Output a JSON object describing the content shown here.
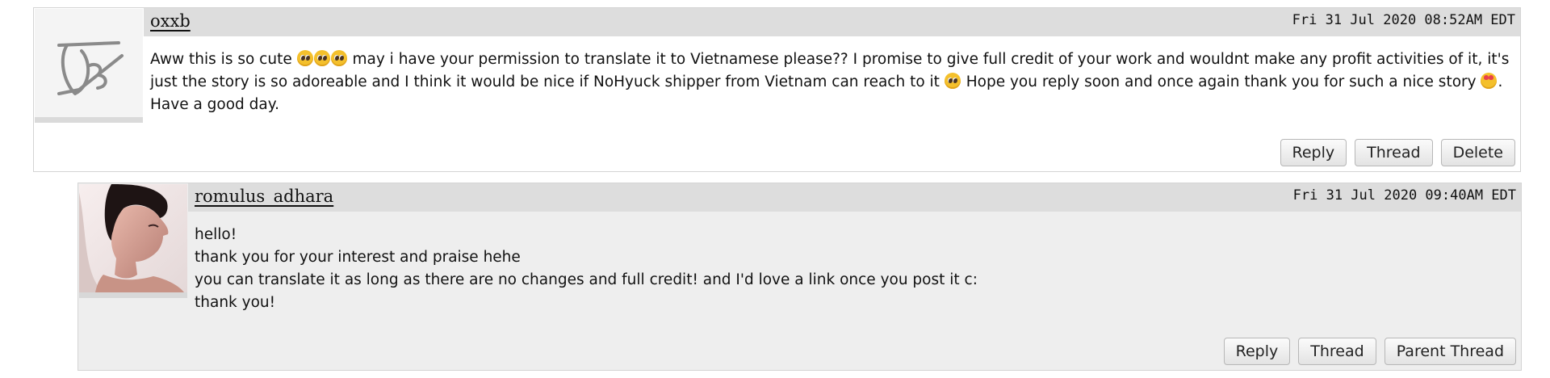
{
  "comments": [
    {
      "user": "oxxb",
      "timestamp": "Fri 31 Jul 2020 08:52AM EDT",
      "avatar_icon": "oxxb-logo-icon",
      "body": {
        "l1a": "Aww this is so cute",
        "l1b": "may i have your permission to translate it to Vietnamese please?? I promise to give full credit of your work and wouldnt make any profit activities of it, it's",
        "l2a": "just the story is so adoreable and I think it would be nice if NoHyuck shipper from Vietnam can reach to it",
        "l2b": "Hope you reply soon and once again thank you for such a nice story",
        "l2c": ".",
        "l3": "Have a good day."
      },
      "buttons": {
        "reply": "Reply",
        "thread": "Thread",
        "delete": "Delete"
      }
    },
    {
      "user": "romulus_adhara",
      "timestamp": "Fri 31 Jul 2020 09:40AM EDT",
      "avatar_icon": "profile-photo",
      "lines": [
        "hello!",
        "thank you for your interest and praise hehe",
        "you can translate it as long as there are no changes and full credit! and I'd love a link once you post it c:",
        "thank you!"
      ],
      "buttons": {
        "reply": "Reply",
        "thread": "Thread",
        "parent_thread": "Parent Thread"
      }
    }
  ],
  "colors": {
    "header_bg": "#dddddd",
    "reply_bg": "#eeeeee",
    "border": "#d4d4d4"
  }
}
